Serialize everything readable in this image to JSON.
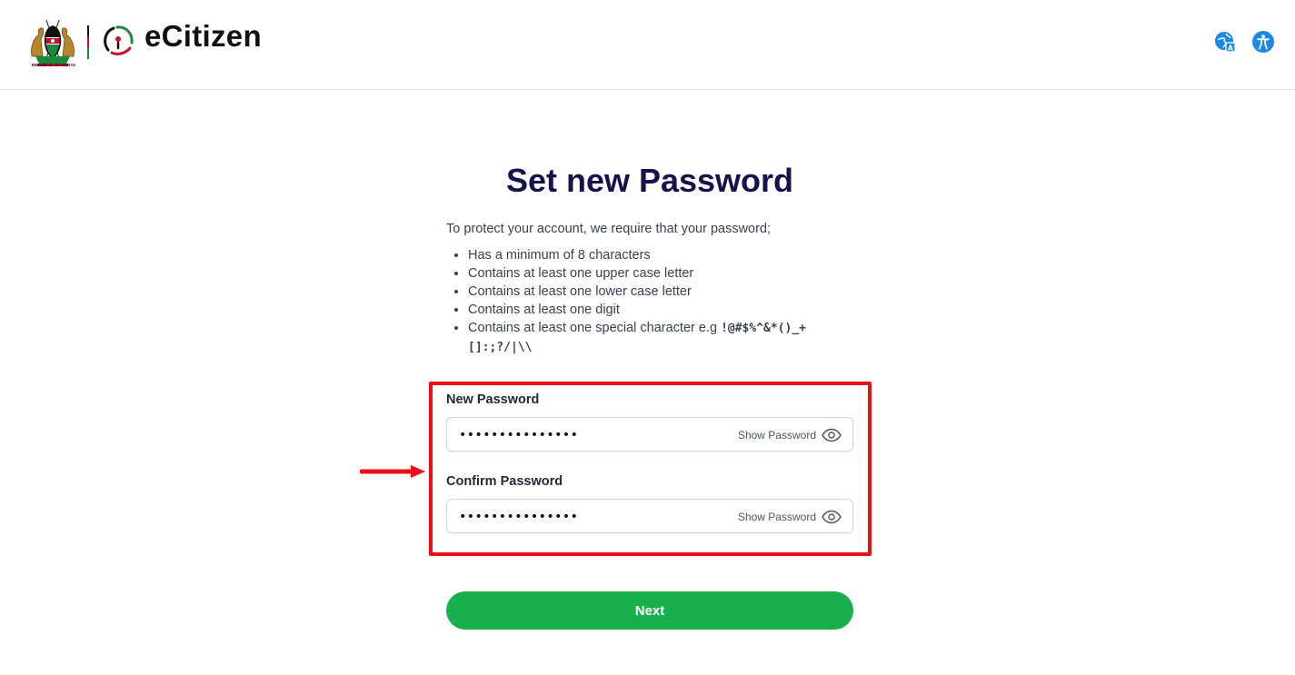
{
  "header": {
    "coat_caption": "REPUBLIC OF KENYA",
    "brand_name": "eCitizen",
    "icons": [
      "language-icon",
      "accessibility-icon"
    ]
  },
  "main": {
    "title": "Set new Password",
    "intro": "To protect your account, we require that your password;",
    "rules": [
      "Has a minimum of 8 characters",
      "Contains at least one upper case letter",
      "Contains at least one lower case letter",
      "Contains at least one digit",
      "Contains at least one special character e.g "
    ],
    "special_chars": "!@#$%^&*()_+[]:;?/|\\\\",
    "new_password": {
      "label": "New Password",
      "value": "•••••••••••••••",
      "toggle_label": "Show Password"
    },
    "confirm_password": {
      "label": "Confirm Password",
      "value": "•••••••••••••••",
      "toggle_label": "Show Password"
    },
    "next_label": "Next"
  },
  "colors": {
    "title": "#16124a",
    "accent_green": "#18b04a",
    "highlight_red": "#ee0f16",
    "icon_blue": "#1e88e5"
  }
}
